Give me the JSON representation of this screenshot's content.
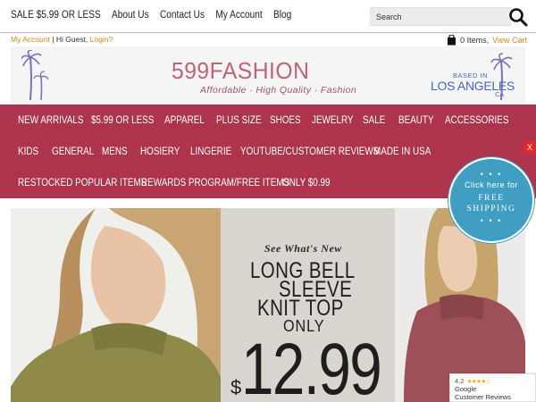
{
  "topnav": {
    "links": [
      "SALE $5.99 OR LESS",
      "About Us",
      "Contact Us",
      "My Account",
      "Blog"
    ],
    "search_placeholder": "Search"
  },
  "account": {
    "my_account": "My Account",
    "greeting": " | Hi Guest, ",
    "login": "Login?",
    "cart_count": "0 Items,",
    "view_cart": "View Cart"
  },
  "banner": {
    "logo": "599FASHION",
    "tagline": "Affordable · High Quality · Fashion",
    "based_line1": "BASED IN",
    "based_line2": "LOS ANGELES",
    "based_line3": "CA"
  },
  "categories": {
    "row1": [
      "NEW ARRIVALS",
      "$5.99 OR LESS",
      "APPAREL",
      "PLUS SIZE",
      "SHOES",
      "JEWELRY",
      "SALE",
      "BEAUTY",
      "ACCESSORIES"
    ],
    "row2": [
      "KIDS",
      "GENERAL",
      "MENS",
      "HOSIERY",
      "LINGERIE",
      "YOUTUBE/CUSTOMER REVIEWS",
      "MADE IN USA"
    ],
    "row3": [
      "RESTOCKED POPULAR ITEMS",
      "REWARDS PROGRAM/FREE ITEMS",
      "ONLY $0.99"
    ]
  },
  "close_label": "X",
  "hero": {
    "kicker": "See What's New",
    "line1": "LONG BELL",
    "line2": "SLEEVE",
    "line3": "KNIT TOP",
    "only": "ONLY",
    "currency": "$",
    "price": "12.99"
  },
  "shipping_badge": {
    "dots": "• • •",
    "line1": "Click here for",
    "line2": "FREE",
    "line3": "SHIPPING"
  },
  "google_badge": {
    "rating": "4.2",
    "stars": "★★★★☆",
    "line1": "Google",
    "line2": "Customer Reviews"
  },
  "colors": {
    "nav_bg": "#ad344c",
    "link_orange": "#d28a13",
    "logo_pink": "#c06475",
    "badge_blue": "#3f9ec1",
    "close_red": "#e2282c"
  }
}
